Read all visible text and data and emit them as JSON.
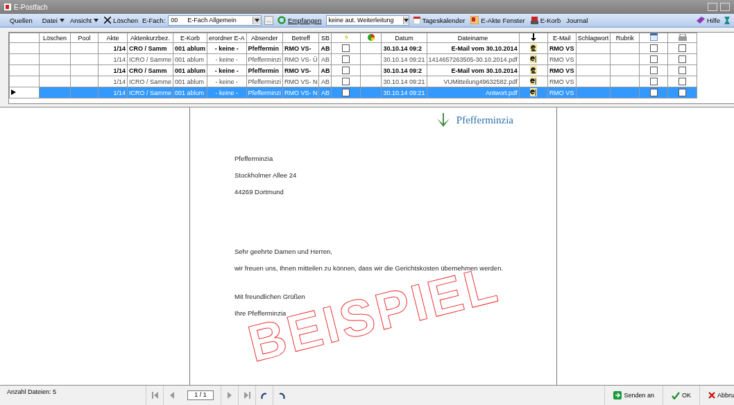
{
  "window": {
    "title": "E-Postfach"
  },
  "toolbar": {
    "quellen": "Quellen",
    "datei": "Datei",
    "ansicht": "Ansicht",
    "loeschen": "Löschen",
    "efach_label": "E-Fach:",
    "efach_code": "00",
    "efach_name": "E-Fach Allgemein",
    "dots": "...",
    "empfangen": "Empfangen",
    "weiterleitung": "keine aut. Weiterleitung",
    "tageskalender": "Tageskalender",
    "eakte": "E-Akte Fenster",
    "ekorb": "E-Korb",
    "journal": "Journal",
    "hilfe": "Hilfe"
  },
  "table": {
    "columns": [
      "Löschen",
      "Pool",
      "Akte",
      "Aktenkurzbez.",
      "E-Korb",
      "erordner E-A",
      "Absender",
      "Betreff",
      "SB",
      "",
      "",
      "Datum",
      "Dateiname",
      "",
      "E-Mail",
      "Schlagwort",
      "Rubrik",
      "",
      ""
    ],
    "rows": [
      {
        "bold": true,
        "selected": false,
        "akte": "1/14",
        "kurz": "CRO / Samm",
        "ekorb": "001 ablum",
        "ordner": "- keine -",
        "absender": "Pfeffermin",
        "betreff": "RMO VS-",
        "sb": "AB",
        "flag": false,
        "datum": "30.10.14 09:2",
        "datei": "E-Mail vom 30.10.2014",
        "kind": "email",
        "email": "RMO VS",
        "cal": false,
        "print": false
      },
      {
        "bold": false,
        "selected": false,
        "akte": "1/14",
        "kurz": "ICRO / Samme",
        "ekorb": "001 ablum",
        "ordner": "- keine -",
        "absender": "Pfefferminzi",
        "betreff": "RMO VS- Ü",
        "sb": "AB",
        "flag": false,
        "datum": "30.10.14 09:21",
        "datei": "1414657263505-30.10.2014.pdf",
        "kind": "file",
        "email": "RMO VS",
        "cal": false,
        "print": false
      },
      {
        "bold": true,
        "selected": false,
        "akte": "1/14",
        "kurz": "CRO / Samm",
        "ekorb": "001 ablum",
        "ordner": "- keine -",
        "absender": "Pfeffermin",
        "betreff": "RMO VS-",
        "sb": "AB",
        "flag": false,
        "datum": "30.10.14 09:2",
        "datei": "E-Mail vom 30.10.2014",
        "kind": "email",
        "email": "RMO VS",
        "cal": false,
        "print": false
      },
      {
        "bold": false,
        "selected": false,
        "akte": "1/14",
        "kurz": "ICRO / Samme",
        "ekorb": "001 ablum",
        "ordner": "- keine -",
        "absender": "Pfefferminzi",
        "betreff": "RMO VS- N",
        "sb": "AB",
        "flag": false,
        "datum": "30.10.14 09:21",
        "datei": "VUMitteilung49632582.pdf",
        "kind": "file",
        "email": "RMO VS",
        "cal": false,
        "print": false
      },
      {
        "bold": false,
        "selected": true,
        "akte": "1/14",
        "kurz": "ICRO / Samme",
        "ekorb": "001 ablum",
        "ordner": "- keine -",
        "absender": "Pfefferminzi",
        "betreff": "RMO VS- N",
        "sb": "AB",
        "flag": false,
        "datum": "30.10.14 09:21",
        "datei": "Antwort.pdf",
        "kind": "file",
        "email": "RMO VS",
        "cal": false,
        "print": false
      }
    ]
  },
  "document": {
    "logo": "Pfefferminzia",
    "address": [
      "Pfefferminzia",
      "Stockholmer Allee 24",
      "44269 Dortmund"
    ],
    "salutation": "Sehr geehrte Damen und Herren,",
    "body": "wir freuen uns, Ihnen mitteilen zu können, dass wir die Gerichtskosten übernehmen werden.",
    "closing": "Mit freundlichen Grüßen",
    "signature": "Ihre Pfefferminzia",
    "stamp": "BEISPIEL"
  },
  "footer": {
    "count": "Anzahl Dateien: 5",
    "page": "1 / 1",
    "send": "Senden an",
    "ok": "OK",
    "cancel": "Abbru"
  }
}
